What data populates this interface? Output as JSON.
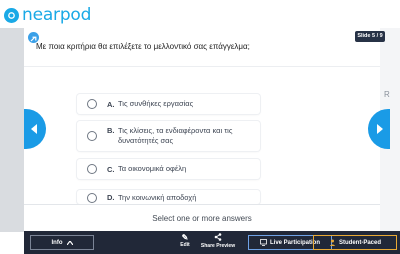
{
  "app": {
    "logo_text": "nearpod"
  },
  "slide": {
    "counter": "Slide 5 / 9",
    "question": "Με ποια κριτήρια θα επιλέξετε το μελλοντικό σας επάγγελμα;",
    "options": [
      {
        "letter": "A.",
        "label": "Τις συνθήκες εργασίας"
      },
      {
        "letter": "B.",
        "label": "Τις κλίσεις, τα ενδιαφέροντα και τις δυνατότητές σας"
      },
      {
        "letter": "C.",
        "label": "Τα οικονομικά οφέλη"
      },
      {
        "letter": "D.",
        "label": "Την κοινωνική αποδοχή"
      }
    ],
    "instruction": "Select one or more answers",
    "edge_letter": "R"
  },
  "toolbar": {
    "info_label": "Info",
    "edit_label": "Edit",
    "share_label": "Share Preview",
    "live_label": "Live Participation",
    "student_label": "Student-Paced"
  },
  "colors": {
    "accent": "#1a9be6",
    "bar": "#212838",
    "student_border": "#e8a935"
  }
}
